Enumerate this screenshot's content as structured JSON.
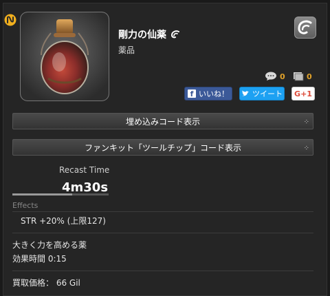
{
  "item": {
    "name": "剛力の仙薬",
    "category": "薬品",
    "patch_icon": "patch-icon",
    "hq_icon": "hq-icon"
  },
  "stats": {
    "comments_count": "0",
    "screenshots_count": "0"
  },
  "share": {
    "facebook_label": "いいね！",
    "twitter_label": "ツイート",
    "gplus_label": "G+1"
  },
  "buttons": {
    "embed_code": "埋め込みコード表示",
    "tooltip_code": "ファンキット「ツールチップ」コード表示"
  },
  "recast": {
    "label": "Recast Time",
    "value": "4m30s",
    "fill": 0.62
  },
  "effects": {
    "label": "Effects",
    "line": "STR +20% (上限127)"
  },
  "description": {
    "line1": "大きく力を高める薬",
    "line2": "効果時間 0:15"
  },
  "sell": {
    "text": "買取価格： 66 Gil"
  },
  "colors": {
    "accent": "#e1a22a",
    "facebook": "#3b5998",
    "twitter": "#1da1f2",
    "gplus": "#dd4b39"
  }
}
